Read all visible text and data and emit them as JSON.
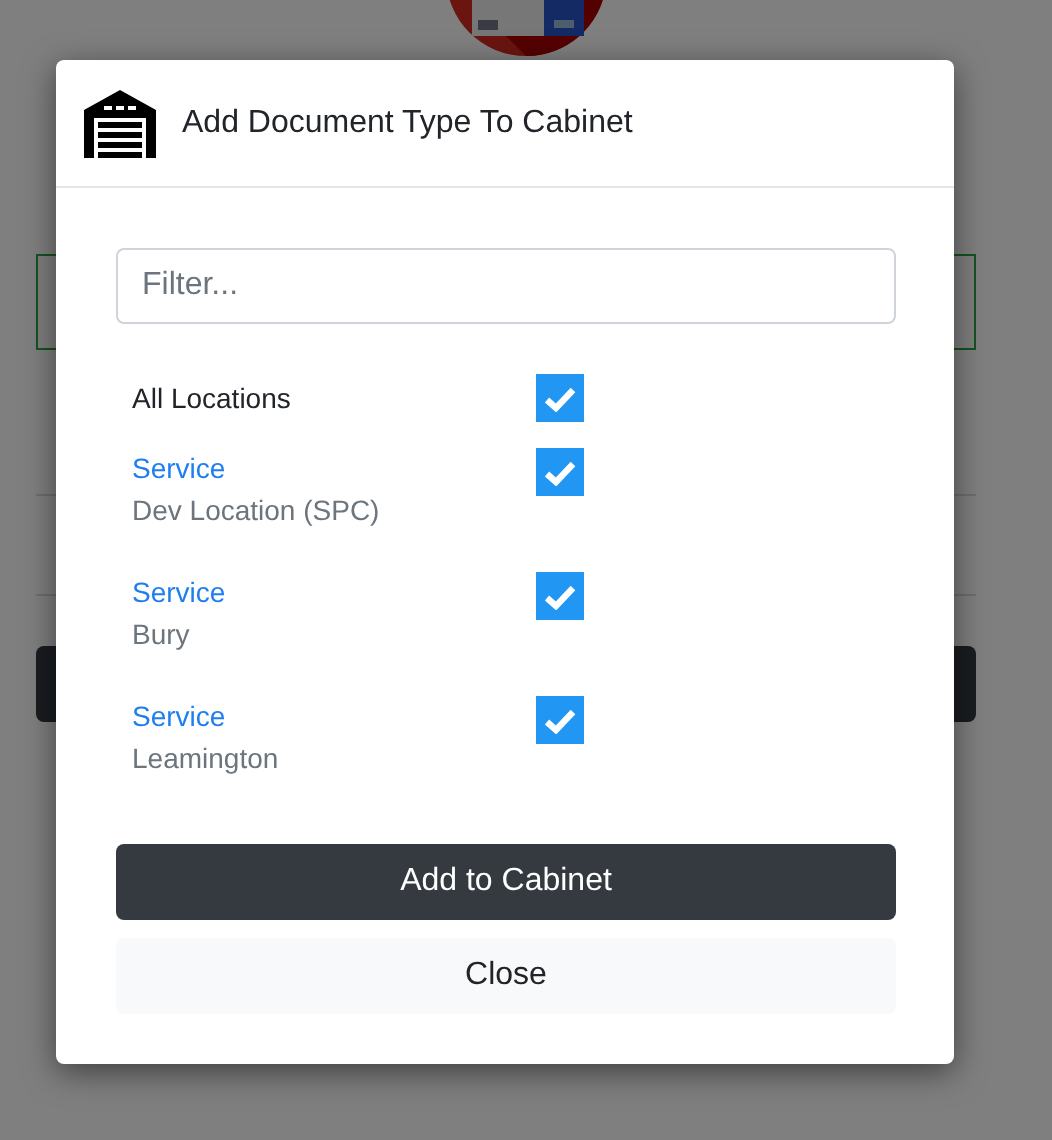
{
  "dialog": {
    "title": "Add Document Type To Cabinet",
    "filter": {
      "placeholder": "Filter..."
    },
    "all_locations": {
      "label": "All Locations",
      "checked": true
    },
    "locations": [
      {
        "department": "Service",
        "name": "Dev Location (SPC)",
        "checked": true
      },
      {
        "department": "Service",
        "name": "Bury",
        "checked": true
      },
      {
        "department": "Service",
        "name": "Leamington",
        "checked": true
      }
    ],
    "buttons": [
      {
        "label": "Add to Cabinet",
        "kind": "primary"
      },
      {
        "label": "Close",
        "kind": "secondary"
      }
    ]
  }
}
